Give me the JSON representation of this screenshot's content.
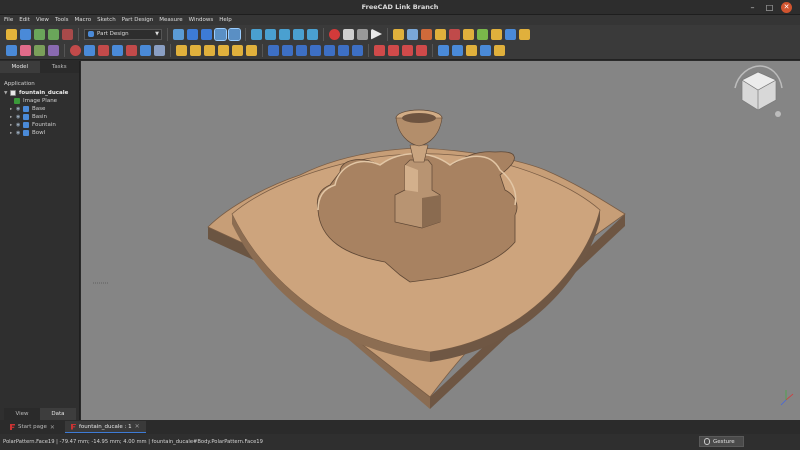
{
  "window": {
    "title": "FreeCAD Link Branch"
  },
  "menu": [
    "File",
    "Edit",
    "View",
    "Tools",
    "Macro",
    "Sketch",
    "Part Design",
    "Measure",
    "Windows",
    "Help"
  ],
  "toolbar": {
    "workbench": "Part Design"
  },
  "combo_view": {
    "tabs": [
      "Model",
      "Tasks"
    ],
    "section": "Application",
    "document": "fountain_ducale",
    "items": [
      "Image Plane",
      "Base",
      "Basin",
      "Fountain",
      "Bowl"
    ],
    "property_tabs": [
      "View",
      "Data"
    ]
  },
  "document_tabs": [
    "Start page",
    "fountain_ducale : 1"
  ],
  "status": {
    "message": "PolarPattern.Face19 | -79.47 mm; -14.95 mm; 4.00 mm | fountain_ducale#Body.PolarPattern.Face19",
    "navigation": "Gesture"
  },
  "colors": {
    "background": "#858585",
    "model": "#c9a07a",
    "accent": "#3d7bd6"
  }
}
